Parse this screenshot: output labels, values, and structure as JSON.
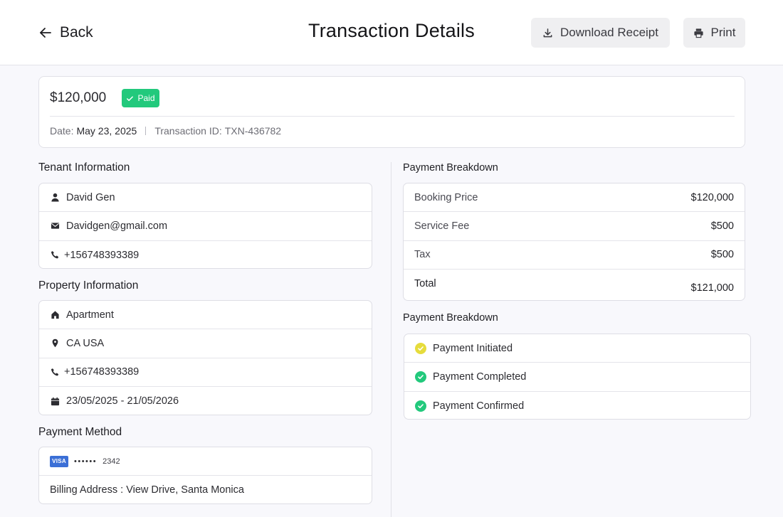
{
  "header": {
    "back_label": "Back",
    "title": "Transaction Details",
    "download_label": "Download Receipt",
    "print_label": "Print"
  },
  "summary": {
    "amount": "$120,000",
    "status": "Paid",
    "status_color": "#22c97c",
    "date_label": "Date:",
    "date_value": "May 23, 2025",
    "transaction_label": "Transaction ID:",
    "transaction_id": "TXN-436782"
  },
  "tenant": {
    "title": "Tenant Information",
    "name": "David Gen",
    "email": "Davidgen@gmail.com",
    "phone": "+156748393389"
  },
  "property": {
    "title": "Property Information",
    "type": "Apartment",
    "location": "CA USA",
    "phone": "+156748393389",
    "dates": "23/05/2025 - 21/05/2026"
  },
  "payment_method": {
    "title": "Payment Method",
    "brand": "VISA",
    "masked": "••••••",
    "last4": "2342",
    "billing": "Billing Address : View Drive, Santa Monica"
  },
  "breakdown": {
    "title": "Payment Breakdown",
    "rows": [
      {
        "label": "Booking Price",
        "value": "$120,000"
      },
      {
        "label": "Service Fee",
        "value": "$500"
      },
      {
        "label": "Tax",
        "value": "$500"
      }
    ],
    "total_label": "Total",
    "total_value": "$121,000"
  },
  "status_timeline": {
    "title": "Payment Breakdown",
    "steps": [
      {
        "label": "Payment Initiated",
        "color": "#e6dc3c"
      },
      {
        "label": "Payment Completed",
        "color": "#22c97c"
      },
      {
        "label": "Payment Confirmed",
        "color": "#22c97c"
      }
    ]
  }
}
